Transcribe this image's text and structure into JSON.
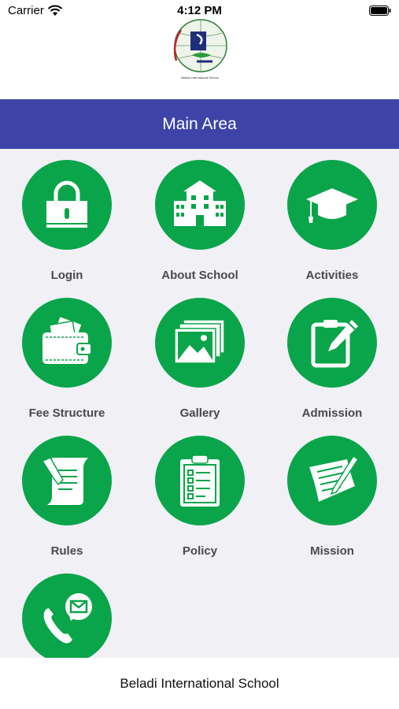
{
  "status_bar": {
    "carrier": "Carrier",
    "time": "4:12 PM"
  },
  "logo": {
    "caption": "Beladi International School"
  },
  "header": {
    "title": "Main Area",
    "color": "#3e44a7"
  },
  "grid": {
    "accent": "#0aa54a",
    "items": [
      {
        "label": "Login",
        "icon": "lock-icon"
      },
      {
        "label": "About School",
        "icon": "school-building-icon"
      },
      {
        "label": "Activities",
        "icon": "graduation-cap-icon"
      },
      {
        "label": "Fee Structure",
        "icon": "wallet-icon"
      },
      {
        "label": "Gallery",
        "icon": "gallery-icon"
      },
      {
        "label": "Admission",
        "icon": "admission-form-icon"
      },
      {
        "label": "Rules",
        "icon": "rules-scroll-icon"
      },
      {
        "label": "Policy",
        "icon": "clipboard-checklist-icon"
      },
      {
        "label": "Mission",
        "icon": "mission-paper-icon"
      },
      {
        "label": "",
        "icon": "contact-phone-mail-icon"
      }
    ]
  },
  "footer": {
    "text": "Beladi International School"
  }
}
